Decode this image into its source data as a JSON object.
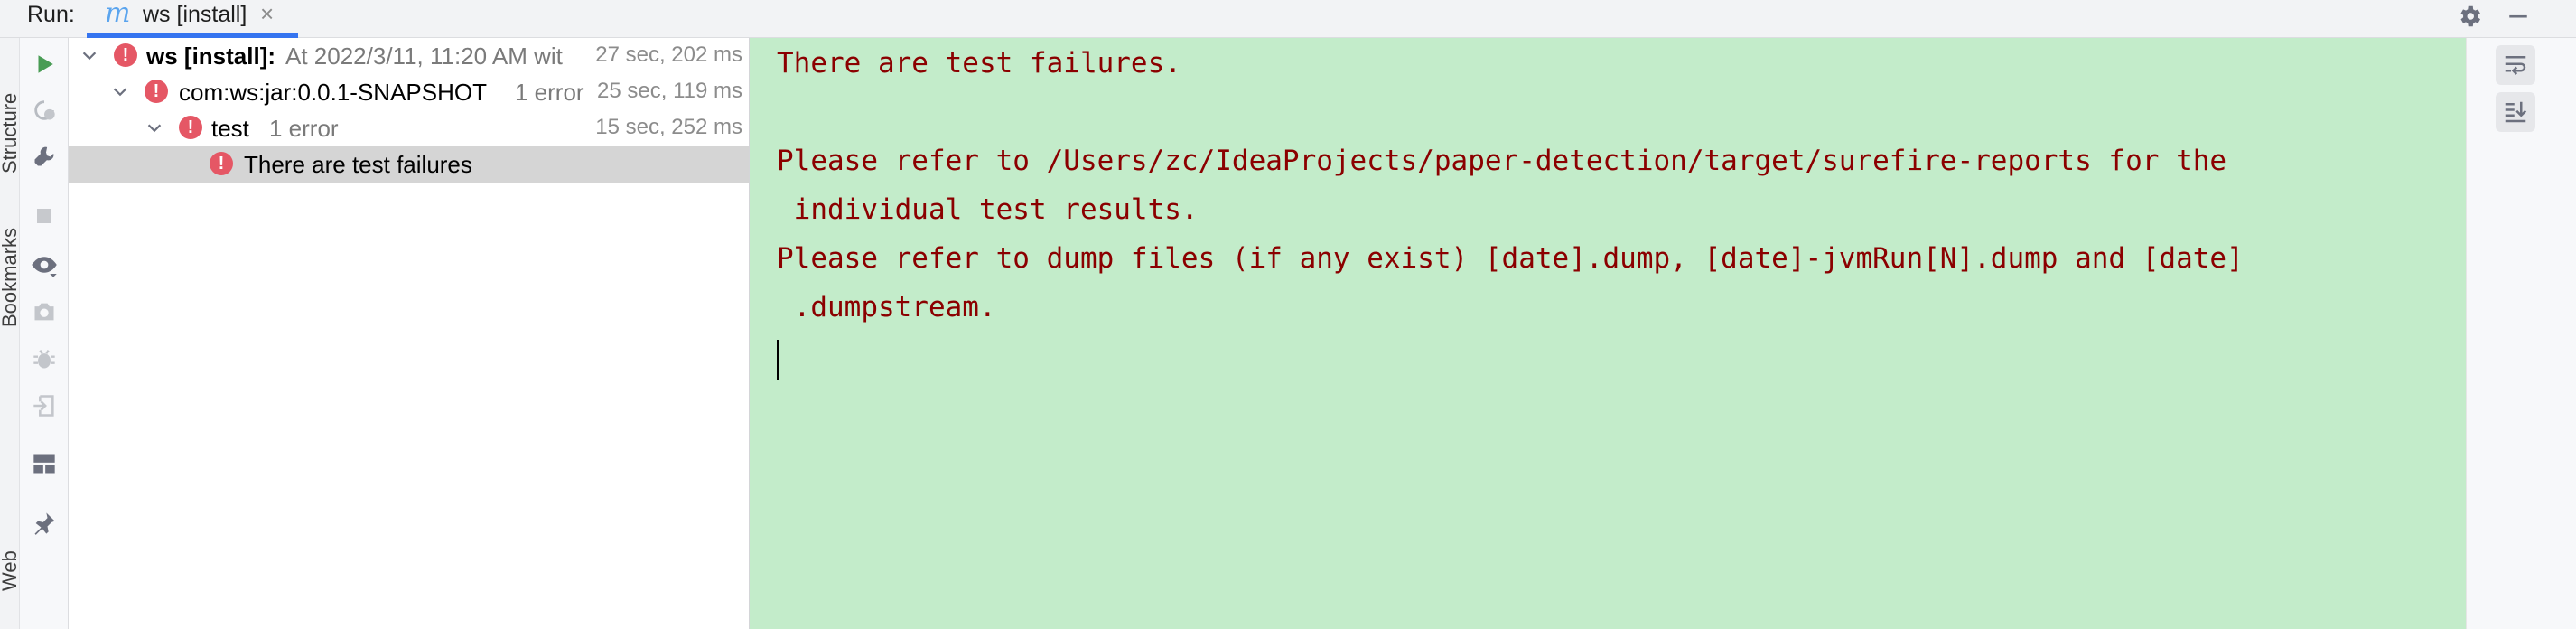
{
  "header": {
    "run_label": "Run:",
    "tab_icon_letter": "m",
    "tab_title": "ws [install]",
    "tab_close": "×"
  },
  "stripe": {
    "labels": [
      "Structure",
      "Bookmarks",
      "Web"
    ]
  },
  "toolbar": {
    "icons": [
      "run-icon",
      "rerun-failed-icon",
      "wrench-icon",
      "stop-icon",
      "eye-icon",
      "camera-icon",
      "bug-icon",
      "import-icon",
      "layout-icon",
      "pin-icon"
    ]
  },
  "tree": {
    "rows": [
      {
        "label": "ws [install]:",
        "detail": "At 2022/3/11, 11:20 AM wit",
        "time": "27 sec, 202 ms"
      },
      {
        "label": "com:ws:jar:0.0.1-SNAPSHOT",
        "detail": "1 error",
        "time": "25 sec, 119 ms"
      },
      {
        "label": "test",
        "detail": "1 error",
        "time": "15 sec, 252 ms"
      },
      {
        "label": "There are test failures",
        "detail": "",
        "time": ""
      }
    ],
    "error_glyph": "!"
  },
  "console": {
    "lines": [
      "There are test failures.",
      "",
      "Please refer to /Users/zc/IdeaProjects/paper-detection/target/surefire-reports for the",
      " individual test results.",
      "Please refer to dump files (if any exist) [date].dump, [date]-jvmRun[N].dump and [date]",
      " .dumpstream."
    ]
  },
  "colors": {
    "accent": "#3574f0",
    "console_bg": "#c3ecca",
    "console_text": "#8b0000",
    "error_icon": "#e55765",
    "run_green": "#499c54",
    "selected_row": "#d5d5d5"
  }
}
